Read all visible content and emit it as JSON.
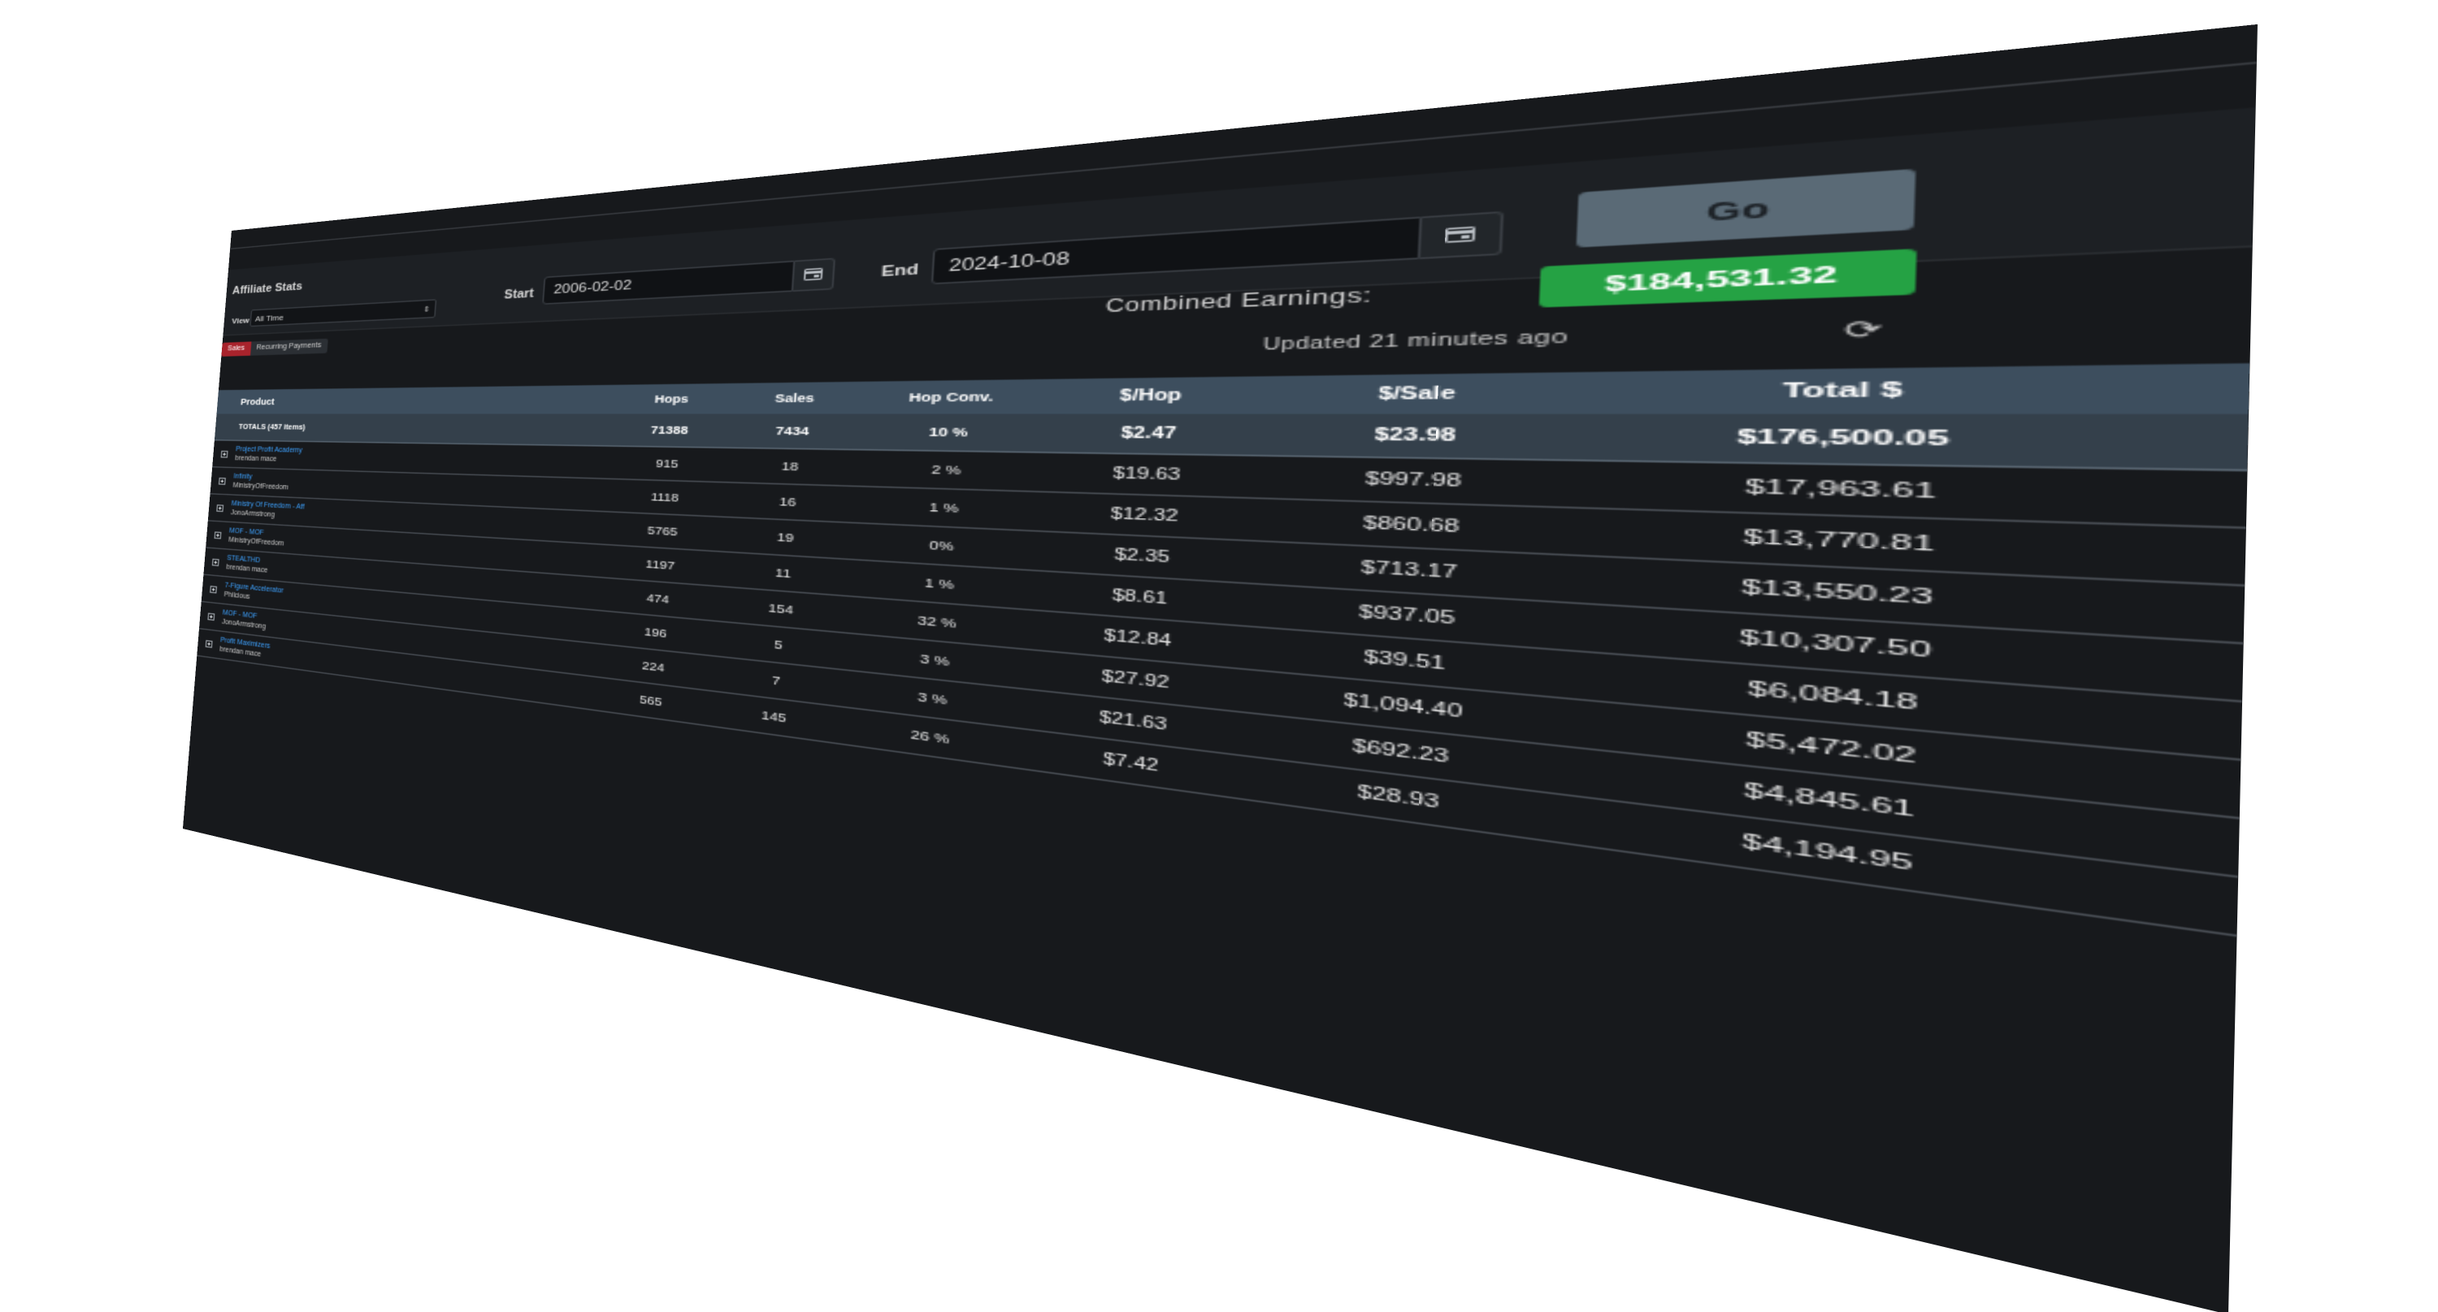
{
  "header": {
    "title": "Affiliate Stats"
  },
  "filters": {
    "view_label": "View",
    "view_value": "All Time",
    "start_label": "Start",
    "start_value": "2006-02-02",
    "end_label": "End",
    "end_value": "2024-10-08",
    "go_label": "Go"
  },
  "tabs": [
    {
      "label": "Sales",
      "active": true
    },
    {
      "label": "Recurring Payments",
      "active": false
    }
  ],
  "earnings": {
    "label": "Combined Earnings:",
    "value": "$184,531.32",
    "updated": "Updated 21 minutes ago"
  },
  "table": {
    "columns": [
      "Product",
      "Hops",
      "Sales",
      "Hop Conv.",
      "$/Hop",
      "$/Sale",
      "Total $"
    ],
    "totals": {
      "label": "TOTALS (457 items)",
      "hops": "71388",
      "sales": "7434",
      "conv": "10 %",
      "per_hop": "$2.47",
      "per_sale": "$23.98",
      "total": "$176,500.05"
    },
    "rows": [
      {
        "name": "Project Profit Academy",
        "vendor": "brendan mace",
        "hops": "915",
        "sales": "18",
        "conv": "2 %",
        "per_hop": "$19.63",
        "per_sale": "$997.98",
        "total": "$17,963.61"
      },
      {
        "name": "Infinity",
        "vendor": "MinistryOfFreedom",
        "hops": "1118",
        "sales": "16",
        "conv": "1 %",
        "per_hop": "$12.32",
        "per_sale": "$860.68",
        "total": "$13,770.81"
      },
      {
        "name": "Ministry Of Freedom - Aff",
        "vendor": "JonoArmstrong",
        "hops": "5765",
        "sales": "19",
        "conv": "0%",
        "per_hop": "$2.35",
        "per_sale": "$713.17",
        "total": "$13,550.23"
      },
      {
        "name": "MOF - MOF",
        "vendor": "MinistryOfFreedom",
        "hops": "1197",
        "sales": "11",
        "conv": "1 %",
        "per_hop": "$8.61",
        "per_sale": "$937.05",
        "total": "$10,307.50"
      },
      {
        "name": "STEALTHD",
        "vendor": "brendan mace",
        "hops": "474",
        "sales": "154",
        "conv": "32 %",
        "per_hop": "$12.84",
        "per_sale": "$39.51",
        "total": "$6,084.18"
      },
      {
        "name": "7-Figure Accelerator",
        "vendor": "Philcious",
        "hops": "196",
        "sales": "5",
        "conv": "3 %",
        "per_hop": "$27.92",
        "per_sale": "$1,094.40",
        "total": "$5,472.02"
      },
      {
        "name": "MOF - MOF",
        "vendor": "JonoArmstrong",
        "hops": "224",
        "sales": "7",
        "conv": "3 %",
        "per_hop": "$21.63",
        "per_sale": "$692.23",
        "total": "$4,845.61"
      },
      {
        "name": "Profit Maximizers",
        "vendor": "brendan mace",
        "hops": "565",
        "sales": "145",
        "conv": "26 %",
        "per_hop": "$7.42",
        "per_sale": "$28.93",
        "total": "$4,194.95"
      }
    ]
  },
  "colors": {
    "background": "#17191c",
    "header_row": "#3d4e5e",
    "earnings_badge": "#25a244",
    "sales_tab": "#a8232c",
    "go_button": "#5a6a76",
    "link": "#3ea2ff"
  }
}
